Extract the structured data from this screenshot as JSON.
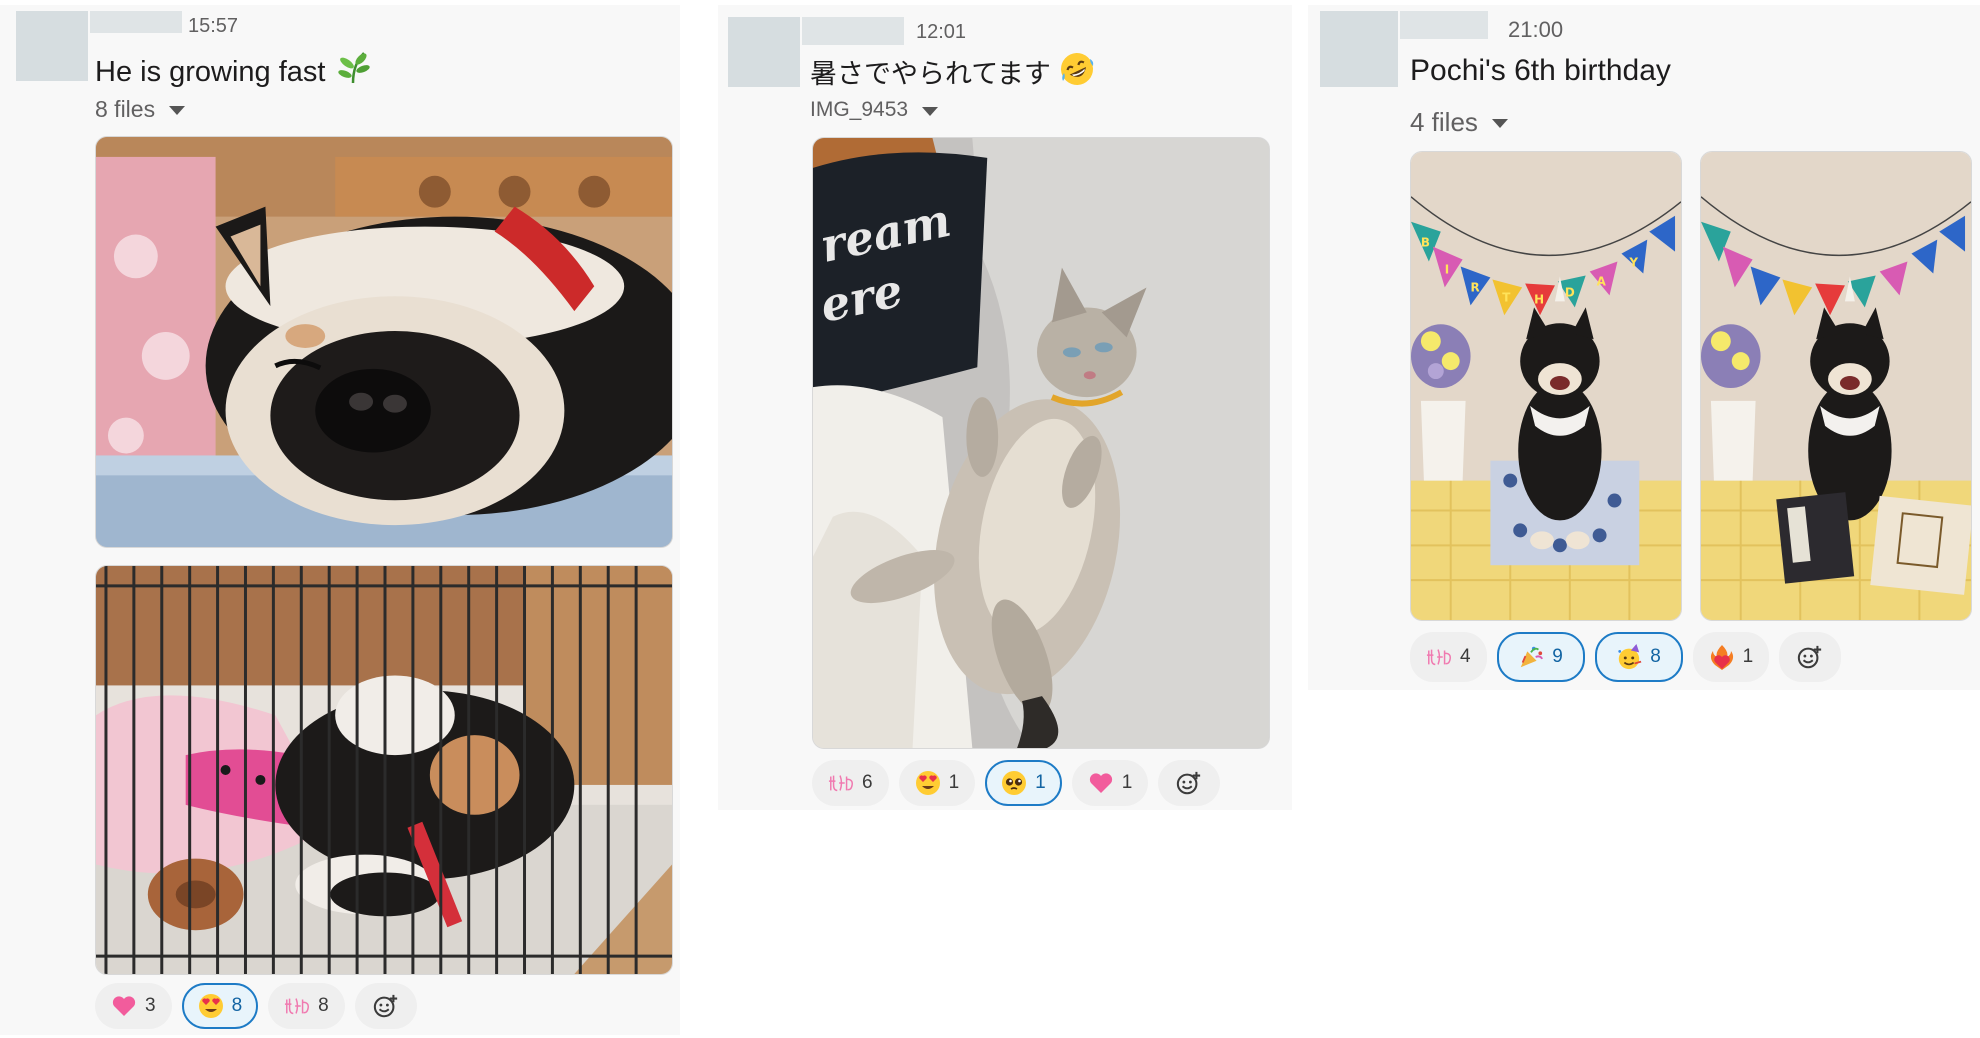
{
  "posts": [
    {
      "time": "15:57",
      "text": "He is growing fast",
      "text_emoji": "herb-icon",
      "attachment_label": "8 files",
      "reactions": [
        {
          "icon": "pink-heart-icon",
          "count": "3",
          "selected": false
        },
        {
          "icon": "heart-eyes-icon",
          "count": "8",
          "selected": true
        },
        {
          "icon": "kawaii-text-icon",
          "count": "8",
          "selected": false
        }
      ]
    },
    {
      "time": "12:01",
      "text": "暑さでやられてます",
      "text_emoji": "rofl-icon",
      "attachment_label": "IMG_9453",
      "reactions": [
        {
          "icon": "kawaii-text-icon",
          "count": "6",
          "selected": false
        },
        {
          "icon": "heart-eyes-icon",
          "count": "1",
          "selected": false
        },
        {
          "icon": "pleading-face-icon",
          "count": "1",
          "selected": true
        },
        {
          "icon": "pink-heart-icon",
          "count": "1",
          "selected": false
        }
      ]
    },
    {
      "time": "21:00",
      "text": "Pochi's 6th birthday",
      "attachment_label": "4 files",
      "reactions": [
        {
          "icon": "kawaii-text-icon",
          "count": "4",
          "selected": false
        },
        {
          "icon": "party-popper-icon",
          "count": "9",
          "selected": true
        },
        {
          "icon": "partying-face-icon",
          "count": "8",
          "selected": true
        },
        {
          "icon": "heart-on-fire-icon",
          "count": "1",
          "selected": false
        }
      ]
    }
  ],
  "banner_text": "BIRTHDAY",
  "pillow_text": "Dream Here",
  "colors": {
    "selected_border": "#1d7bc6",
    "selected_fill": "#e8f4fb",
    "panel": "#f8f8f8"
  }
}
